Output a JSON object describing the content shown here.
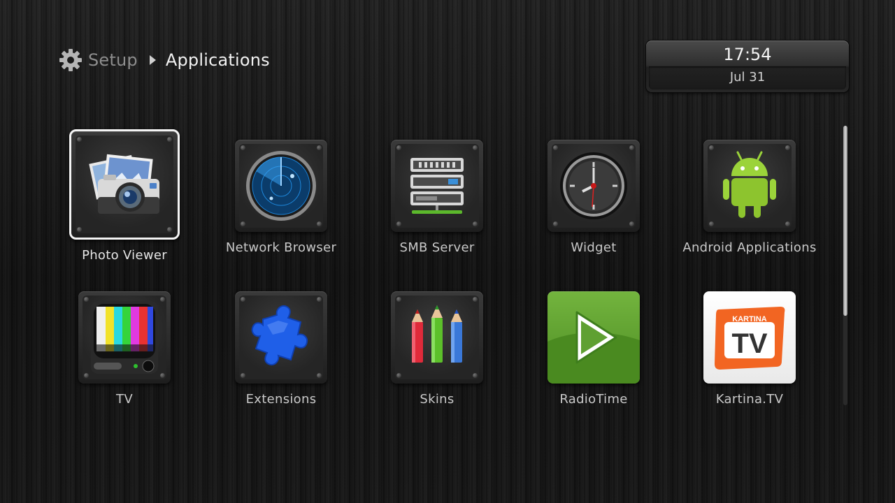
{
  "breadcrumb": {
    "icon": "gear-icon",
    "parent": "Setup",
    "separator_icon": "triangle-right-icon",
    "current": "Applications"
  },
  "clock": {
    "time": "17:54",
    "date": "Jul 31"
  },
  "apps": [
    {
      "label": "Photo Viewer",
      "icon": "photo-viewer-icon",
      "selected": true
    },
    {
      "label": "Network Browser",
      "icon": "radar-icon",
      "selected": false
    },
    {
      "label": "SMB Server",
      "icon": "server-rack-icon",
      "selected": false
    },
    {
      "label": "Widget",
      "icon": "clock-icon",
      "selected": false
    },
    {
      "label": "Android Applications",
      "icon": "android-icon",
      "selected": false
    },
    {
      "label": "TV",
      "icon": "tv-icon",
      "selected": false
    },
    {
      "label": "Extensions",
      "icon": "puzzle-piece-icon",
      "selected": false
    },
    {
      "label": "Skins",
      "icon": "pencils-icon",
      "selected": false
    },
    {
      "label": "RadioTime",
      "icon": "play-icon",
      "selected": false
    },
    {
      "label": "Kartina.TV",
      "icon": "kartina-tv-logo-icon",
      "selected": false,
      "logo_text": [
        "KARTINA",
        "TV"
      ]
    }
  ],
  "scrollbar": {
    "visible_fraction": 0.68,
    "position": 0
  },
  "colors": {
    "selection_border": "#f4f4f4",
    "radiotime_green": "#5fa032",
    "kartina_orange": "#f26522"
  }
}
